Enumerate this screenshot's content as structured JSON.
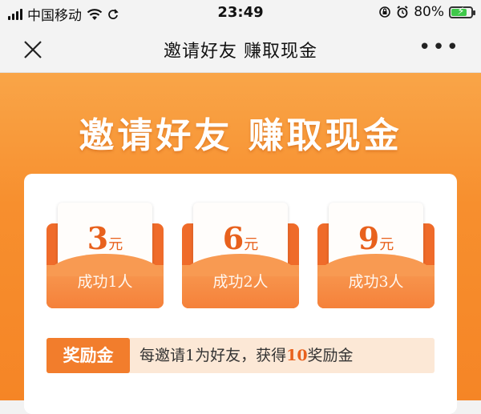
{
  "status_bar": {
    "carrier": "中国移动",
    "time": "23:49",
    "battery": "80%",
    "battery_level": 0.8
  },
  "nav": {
    "title": "邀请好友 赚取现金"
  },
  "hero": {
    "title": "邀请好友 赚取现金"
  },
  "rewards": [
    {
      "amount": "3",
      "unit": "元",
      "label": "成功1人"
    },
    {
      "amount": "6",
      "unit": "元",
      "label": "成功2人"
    },
    {
      "amount": "9",
      "unit": "元",
      "label": "成功3人"
    }
  ],
  "bonus": {
    "badge": "奖励金",
    "text_prefix": "每邀请1为好友，获得",
    "highlight": "10",
    "text_suffix": "奖励金"
  },
  "colors": {
    "orange": "#f78f2e",
    "accent": "#e8611d",
    "battery_green": "#3fc94a"
  }
}
